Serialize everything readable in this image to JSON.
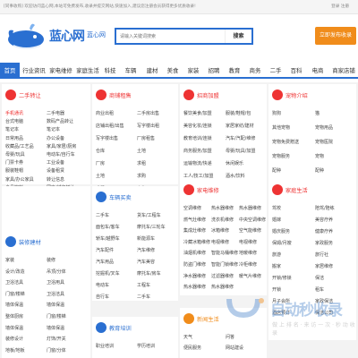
{
  "topbar": {
    "notice": "[同事收购] 欢迎访问蓝心网,本站可免费发布,收录并提交网站,快速加入,建议您注册会员获得更多优质收录!",
    "login": "登录 注册"
  },
  "header": {
    "brand": "蓝心网",
    "sub": "蓝心网",
    "search_placeholder": "请输入关键词搜索",
    "search_btn": "搜索",
    "free_btn": "立即发布收录"
  },
  "nav": [
    "首页",
    "行业资讯",
    "家电维修",
    "家庭生活",
    "科技",
    "车辆",
    "建材",
    "美食",
    "家装",
    "招聘",
    "教育",
    "商务",
    "二手",
    "百科",
    "电商",
    "商家店铺"
  ],
  "panels": {
    "ershou": {
      "title": "二手转让",
      "color": "#e33",
      "items": [
        [
          "手机通讯",
          "二手电器"
        ],
        [
          "台式电脑",
          "数码产品转让"
        ],
        [
          "笔记本",
          "笔记本"
        ],
        [
          "日常用品",
          "办公设备"
        ],
        [
          "收藏品/工艺品",
          "家具/家居/厨房"
        ],
        [
          "母婴/玩具",
          "电动车/自行车"
        ],
        [
          "门票卡券",
          "工业设备"
        ],
        [
          "服装鞋帽",
          "设备租赁"
        ],
        [
          "家具/办公家具",
          "转让信息"
        ],
        [
          "食品饮料",
          "网店/域名转让"
        ],
        [
          "手机维修",
          "网站建设"
        ]
      ]
    },
    "shangwu": {
      "title": "商铺租售",
      "color": "#e33",
      "items": [
        [
          "商业出租",
          "二手房出售"
        ],
        [
          "店铺出租/出售",
          "写字楼出租"
        ],
        [
          "写字楼出售",
          "厂房租售"
        ],
        [
          "仓库",
          "土地"
        ],
        [
          "厂房",
          "求租"
        ],
        [
          "土地",
          "求购"
        ],
        [
          "求租",
          "合作"
        ],
        [
          "办公楼盘",
          ""
        ]
      ]
    },
    "zhaopin": {
      "title": "招商加盟",
      "color": "#e33",
      "items": [
        [
          "餐饮美食/加盟",
          "服装/鞋帽/包"
        ],
        [
          "美容化妆/连锁",
          "家居家纺/建材"
        ],
        [
          "教育培训/连锁",
          "汽车/汽配/维修"
        ],
        [
          "商务服务/加盟",
          "母婴/玩具/加盟"
        ],
        [
          "运输物流/快递",
          "休闲娱乐"
        ],
        [
          "工人/技工/加盟",
          "酒水/饮料"
        ],
        [
          "美工/设计/加盟",
          "人才招聘专栏"
        ]
      ]
    },
    "chongwu": {
      "title": "宠物介绍",
      "color": "#e33",
      "items": [
        [
          "狗狗",
          "猫"
        ],
        [
          "其他宠物",
          "宠物用品"
        ],
        [
          "宠物免费赠送",
          "宠物医院"
        ],
        [
          "宠物服务",
          "宠物"
        ],
        [
          "配种",
          "配种"
        ]
      ]
    },
    "jiadian": {
      "title": "家电维修",
      "color": "#e33",
      "items": [
        [
          "空调维修",
          "热水器维修",
          "热水器维修"
        ],
        [
          "燃气灶维修",
          "洗衣机维修",
          "中央空调维修"
        ],
        [
          "集成灶维修",
          "冰箱维修",
          "空气能维修"
        ],
        [
          "冷藏冰箱维修",
          "电视维修",
          "电视维修"
        ],
        [
          "油烟机维修",
          "智能马桶维修",
          "地暖维修"
        ],
        [
          "防盗门维修",
          "智能门锁维修",
          "冷柜维修"
        ],
        [
          "净水器维修",
          "过滤器维修",
          "暖气片维修"
        ],
        [
          "热水器维修",
          "热水器维修",
          ""
        ]
      ]
    },
    "jiating": {
      "title": "家庭生活",
      "color": "#e33",
      "items": [
        [
          "驾校",
          "陪驾/陪练"
        ],
        [
          "婚嫁",
          "美容疗养"
        ],
        [
          "婚庆服务",
          "健康疗养"
        ],
        [
          "保姆/月嫂",
          "家政服务"
        ],
        [
          "旅游",
          "旅行社"
        ],
        [
          "搬家",
          "家居维修"
        ],
        [
          "开锁/修锁",
          "保洁"
        ],
        [
          "开锁",
          "租车"
        ],
        [
          "月子会所",
          "家政保洁"
        ],
        [
          "酒店预订",
          "保洁公司"
        ]
      ]
    },
    "cheliang": {
      "title": "车辆买卖",
      "color": "#2a6fd1",
      "items": [
        [
          "二手车",
          "货车/工程车"
        ],
        [
          "面包车/客车",
          "摩托车/三轮车"
        ],
        [
          "轿车/越野车",
          "新能源车"
        ],
        [
          "汽车配件",
          "汽车维修"
        ],
        [
          "汽车用品",
          "汽车美容"
        ],
        [
          "挖掘机/叉车",
          "摩托车/房车"
        ],
        [
          "电动车",
          "工程车"
        ],
        [
          "自行车",
          "二手车"
        ]
      ]
    },
    "jiancai": {
      "title": "装修建材",
      "color": "#2a6fd1",
      "items": [
        [
          "家装",
          "装修"
        ],
        [
          "设计/改造",
          "吊顶/分体"
        ],
        [
          "卫浴洁具",
          "卫浴用具"
        ],
        [
          "门窗/楼梯",
          "卫浴洁具"
        ],
        [
          "墙体保温",
          "墙体保温"
        ],
        [
          "整体厨房",
          "门窗/楼梯"
        ],
        [
          "墙体保温",
          "墙体保温"
        ],
        [
          "装修设计",
          "灯饰/开关"
        ],
        [
          "地板/地板",
          "门窗/分体"
        ]
      ]
    },
    "jiaoyu": {
      "title": "教育培训",
      "color": "#2a6fd1",
      "items": [
        [
          "职业培训",
          "学历培训"
        ]
      ]
    },
    "shenghuo": {
      "title": "新闻生活",
      "color": "#f08c1b",
      "items": [
        [
          "天气",
          "问答"
        ],
        [
          "便民服务",
          "网站建设"
        ]
      ]
    }
  },
  "watermark": {
    "title": "自动秒收录",
    "sub": "做 上 排 名 · 来 访 一 次 · 秒 动 收 录"
  }
}
